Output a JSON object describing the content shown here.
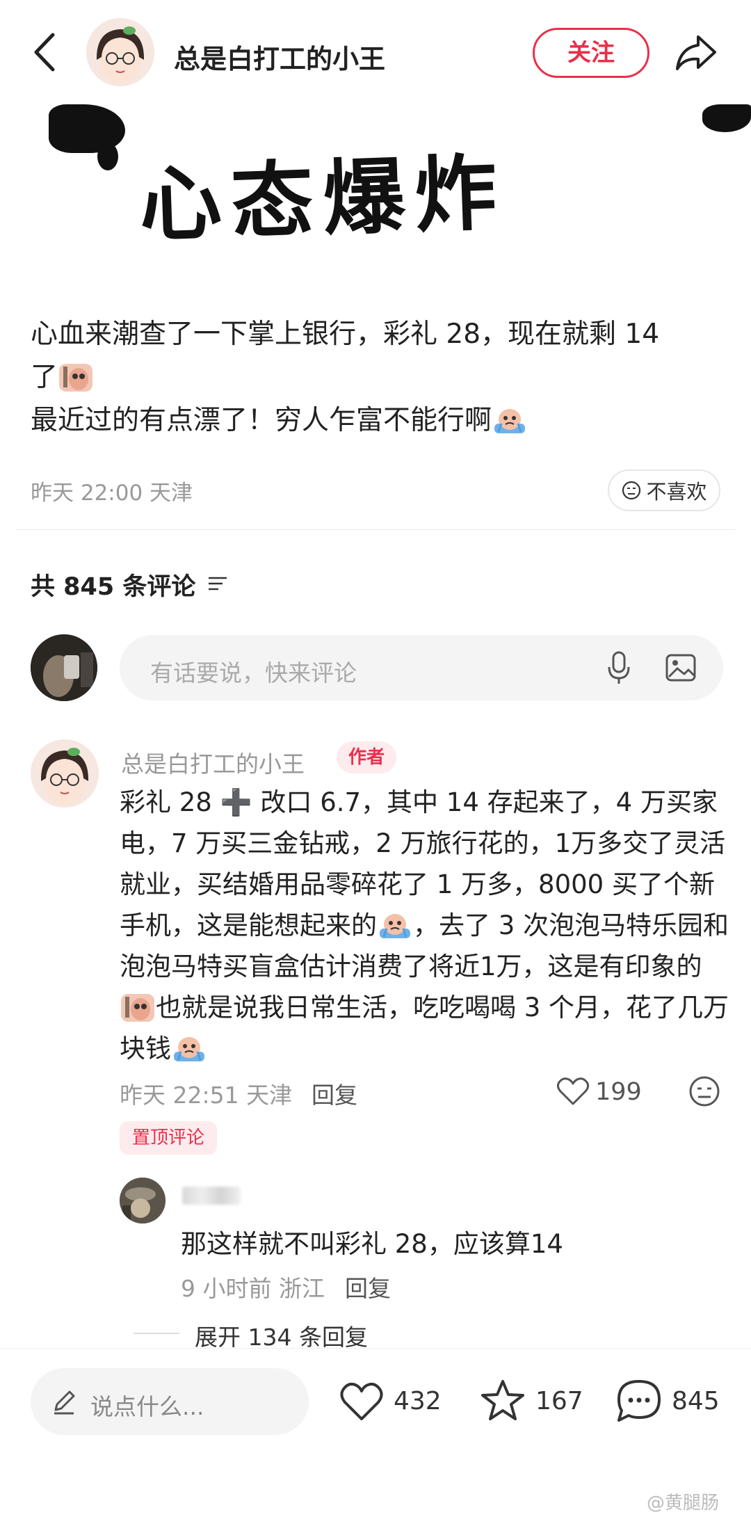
{
  "header": {
    "author_name": "总是白打工的小王",
    "follow_label": "关注"
  },
  "banner": {
    "text": "心态爆炸"
  },
  "post": {
    "line1": "心血来潮查了一下掌上银行，彩礼 28，现在就剩 14",
    "line2": "了",
    "line3": "最近过的有点漂了！穷人乍富不能行啊",
    "meta": "昨天 22:00 天津",
    "dislike_label": "不喜欢"
  },
  "comments": {
    "count_label": "共 845 条评论",
    "input_placeholder": "有话要说，快来评论"
  },
  "top_comment": {
    "name": "总是白打工的小王",
    "badge": "作者",
    "text_part1": "彩礼 28 ➕ 改口 6.7，其中 14 存起来了，4 万买家电，7 万买三金钻戒，2 万旅行花的，1万多交了灵活就业，买结婚用品零碎花了 1 万多，8000 买了个新手机，这是能想起来的",
    "text_part2": "，去了 3 次泡泡马特乐园和泡泡马特买盲盒估计消费了将近1万，这是有印象的",
    "text_part3": "也就是说我日常生活，吃吃喝喝 3 个月，花了几万块钱",
    "meta": "昨天 22:51 天津",
    "reply_label": "回复",
    "likes": "199",
    "pinned_label": "置顶评论"
  },
  "reply": {
    "text": "那这样就不叫彩礼 28，应该算14",
    "meta": "9 小时前 浙江",
    "reply_label": "回复",
    "expand_label": "展开 134 条回复"
  },
  "bottom_bar": {
    "placeholder": "说点什么...",
    "likes": "432",
    "stars": "167",
    "comments": "845"
  },
  "watermark": "@黄腿肠",
  "colors": {
    "accent": "#e8304a",
    "muted": "#999999"
  }
}
